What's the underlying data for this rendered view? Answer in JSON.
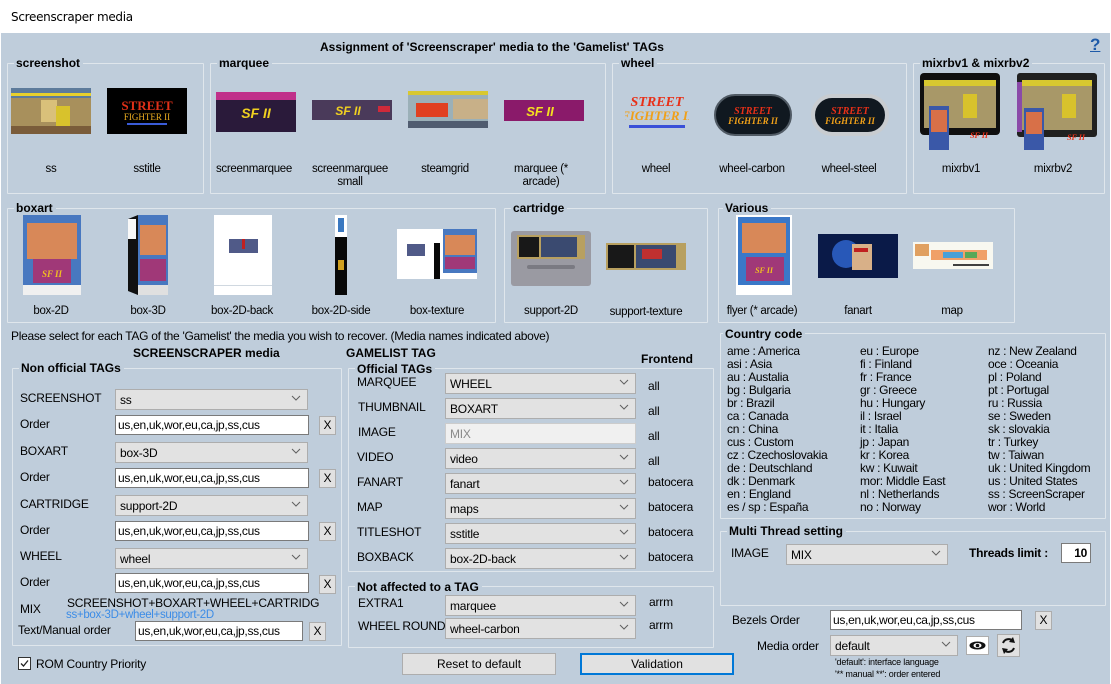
{
  "window": {
    "title": "Screenscraper media"
  },
  "header": {
    "title": "Assignment of 'Screenscraper' media to the 'Gamelist' TAGs",
    "help": "?"
  },
  "media_groups": {
    "screenshot": {
      "label": "screenshot",
      "items": [
        {
          "name": "ss"
        },
        {
          "name": "sstitle"
        }
      ]
    },
    "marquee": {
      "label": "marquee",
      "items": [
        {
          "name": "screenmarquee"
        },
        {
          "name": "screenmarquee small"
        },
        {
          "name": "steamgrid"
        },
        {
          "name": "marquee (* arcade)"
        }
      ]
    },
    "wheel": {
      "label": "wheel",
      "items": [
        {
          "name": "wheel"
        },
        {
          "name": "wheel-carbon"
        },
        {
          "name": "wheel-steel"
        }
      ]
    },
    "mixrbv": {
      "label": "mixrbv1 & mixrbv2",
      "items": [
        {
          "name": "mixrbv1"
        },
        {
          "name": "mixrbv2"
        }
      ]
    },
    "boxart": {
      "label": "boxart",
      "items": [
        {
          "name": "box-2D"
        },
        {
          "name": "box-3D"
        },
        {
          "name": "box-2D-back"
        },
        {
          "name": "box-2D-side"
        },
        {
          "name": "box-texture"
        }
      ]
    },
    "cartridge": {
      "label": "cartridge",
      "items": [
        {
          "name": "support-2D"
        },
        {
          "name": "support-texture"
        }
      ]
    },
    "various": {
      "label": "Various",
      "items": [
        {
          "name": "flyer (* arcade)"
        },
        {
          "name": "fanart"
        },
        {
          "name": "map"
        }
      ]
    }
  },
  "instruction": "Please select for each TAG of the 'Gamelist' the media you wish to recover. (Media names indicated above)",
  "screenscraper_heading": "SCREENSCRAPER media",
  "gamelist_heading": "GAMELIST TAG",
  "frontend_heading": "Frontend",
  "non_official": {
    "label": "Non official TAGs",
    "order_label": "Order",
    "rows": [
      {
        "tag": "SCREENSHOT",
        "value": "ss",
        "order": "us,en,uk,wor,eu,ca,jp,ss,cus"
      },
      {
        "tag": "BOXART",
        "value": "box-3D",
        "order": "us,en,uk,wor,eu,ca,jp,ss,cus"
      },
      {
        "tag": "CARTRIDGE",
        "value": "support-2D",
        "order": "us,en,uk,wor,eu,ca,jp,ss,cus"
      },
      {
        "tag": "WHEEL",
        "value": "wheel",
        "order": "us,en,uk,wor,eu,ca,jp,ss,cus"
      }
    ],
    "clear_label": "X",
    "mix_label": "MIX",
    "mix_tags": "SCREENSHOT+BOXART+WHEEL+CARTRIDG",
    "mix_media": "ss+box-3D+wheel+support-2D",
    "mix_media_color": "#3c8ce6",
    "text_manual_label": "Text/Manual order",
    "text_manual_value": "us,en,uk,wor,eu,ca,jp,ss,cus"
  },
  "rom_country_priority": {
    "label": "ROM Country Priority",
    "checked": true
  },
  "official": {
    "label": "Official TAGs",
    "rows": [
      {
        "tag": "MARQUEE",
        "value": "WHEEL",
        "frontend": "all",
        "disabled": false
      },
      {
        "tag": "THUMBNAIL",
        "value": "BOXART",
        "frontend": "all",
        "disabled": false
      },
      {
        "tag": "IMAGE",
        "value": "MIX",
        "frontend": "all",
        "disabled": true
      },
      {
        "tag": "VIDEO",
        "value": "video",
        "frontend": "all",
        "disabled": false
      },
      {
        "tag": "FANART",
        "value": "fanart",
        "frontend": "batocera",
        "disabled": false
      },
      {
        "tag": "MAP",
        "value": "maps",
        "frontend": "batocera",
        "disabled": false
      },
      {
        "tag": "TITLESHOT",
        "value": "sstitle",
        "frontend": "batocera",
        "disabled": false
      },
      {
        "tag": "BOXBACK",
        "value": "box-2D-back",
        "frontend": "batocera",
        "disabled": false
      }
    ]
  },
  "not_affected": {
    "label": "Not affected to a TAG",
    "rows": [
      {
        "tag": "EXTRA1",
        "value": "marquee",
        "frontend": "arrm"
      },
      {
        "tag": "WHEEL ROUND",
        "value": "wheel-carbon",
        "frontend": "arrm"
      }
    ]
  },
  "country_code": {
    "label": "Country code",
    "columns": [
      [
        "ame : America",
        "asi : Asia",
        "au : Austalia",
        "bg : Bulgaria",
        "br : Brazil",
        "ca : Canada",
        "cn : China",
        "cus : Custom",
        "cz : Czechoslovakia",
        "de : Deutschland",
        "dk : Denmark",
        "en : England",
        "es / sp : España"
      ],
      [
        "eu : Europe",
        "fi : Finland",
        "fr : France",
        "gr : Greece",
        "hu : Hungary",
        "il : Israel",
        "it : Italia",
        "jp : Japan",
        "kr : Korea",
        "kw : Kuwait",
        "mor: Middle East",
        "nl : Netherlands",
        "no : Norway"
      ],
      [
        "nz : New Zealand",
        "oce : Oceania",
        "pl : Poland",
        "pt : Portugal",
        "ru : Russia",
        "se : Sweden",
        "sk : slovakia",
        "tr : Turkey",
        "tw : Taiwan",
        "uk : United Kingdom",
        "us : United States",
        "ss : ScreenScraper",
        "wor : World"
      ]
    ]
  },
  "multi_thread": {
    "label": "Multi Thread setting",
    "image_label": "IMAGE",
    "image_value": "MIX",
    "threads_label": "Threads limit :",
    "threads_value": "10"
  },
  "bezels": {
    "label": "Bezels Order",
    "value": "us,en,uk,wor,eu,ca,jp,ss,cus",
    "clear": "X"
  },
  "media_order": {
    "label": "Media order",
    "value": "default",
    "note1": "'default': interface language",
    "note2": "'** manual **': order entered"
  },
  "buttons": {
    "reset": "Reset to default",
    "validation": "Validation"
  }
}
